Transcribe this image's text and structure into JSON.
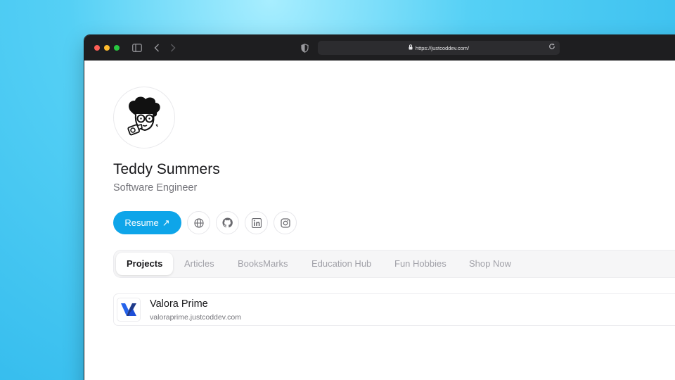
{
  "browser": {
    "url": "https://justcoddev.com/",
    "icons": [
      "sidebar-icon",
      "back-icon",
      "forward-icon",
      "shield-icon",
      "lock-icon",
      "reload-icon"
    ]
  },
  "profile": {
    "name": "Teddy Summers",
    "role": "Software Engineer"
  },
  "actions": {
    "resume_label": "Resume",
    "resume_icon": "↗",
    "social_icons": [
      "globe-icon",
      "github-icon",
      "linkedin-icon",
      "instagram-icon"
    ],
    "accent": "#0ea5e9"
  },
  "tabs": [
    {
      "label": "Projects",
      "active": true
    },
    {
      "label": "Articles"
    },
    {
      "label": "BooksMarks"
    },
    {
      "label": "Education Hub"
    },
    {
      "label": "Fun Hobbies"
    },
    {
      "label": "Shop Now"
    }
  ],
  "projects": [
    {
      "name": "Valora Prime",
      "url": "valoraprime.justcoddev.com"
    }
  ]
}
